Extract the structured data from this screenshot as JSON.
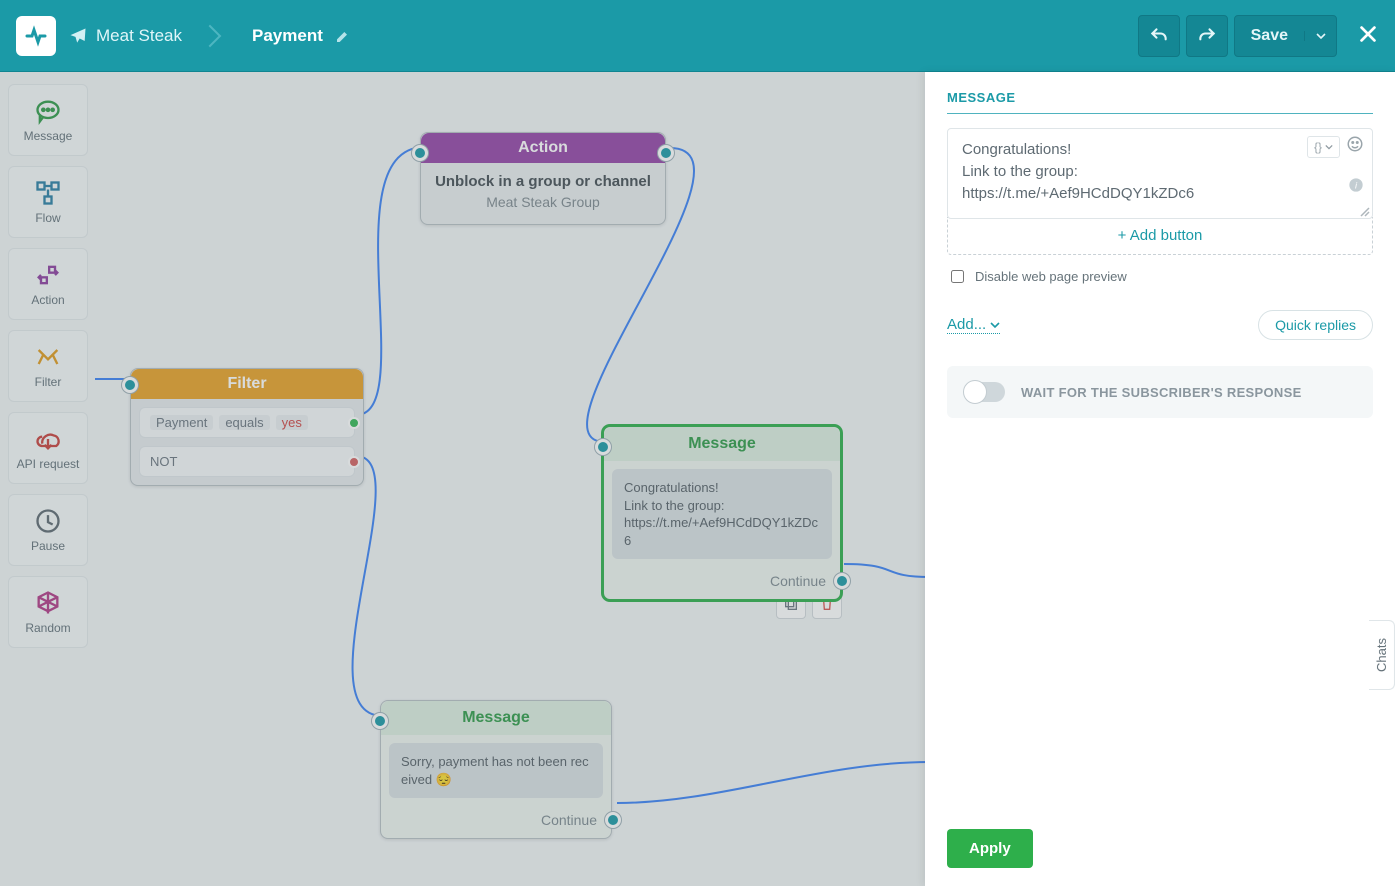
{
  "topbar": {
    "project": "Meat Steak",
    "page": "Payment",
    "save": "Save"
  },
  "sidebar": {
    "items": [
      {
        "label": "Message",
        "icon": "message",
        "color": "#2f9b49"
      },
      {
        "label": "Flow",
        "icon": "flow",
        "color": "#2a7fa5"
      },
      {
        "label": "Action",
        "icon": "action",
        "color": "#8e3fa0"
      },
      {
        "label": "Filter",
        "icon": "filter",
        "color": "#e09b1e"
      },
      {
        "label": "API request",
        "icon": "api",
        "color": "#c9403c"
      },
      {
        "label": "Pause",
        "icon": "pause",
        "color": "#5e6a72"
      },
      {
        "label": "Random",
        "icon": "random",
        "color": "#b23a87"
      }
    ]
  },
  "nodes": {
    "action": {
      "header": "Action",
      "title": "Unblock in a group or channel",
      "subtitle": "Meat Steak Group"
    },
    "filter": {
      "header": "Filter",
      "cond_field": "Payment",
      "cond_op": "equals",
      "cond_value": "yes",
      "not_label": "NOT"
    },
    "msg1": {
      "header": "Message",
      "text": "Congratulations!\nLink to the group:\nhttps://t.me/+Aef9HCdDQY1kZDc6",
      "continue": "Continue"
    },
    "msg2": {
      "header": "Message",
      "text": "Sorry, payment has not been received 😔",
      "continue": "Continue"
    }
  },
  "panel": {
    "title": "MESSAGE",
    "content": "Congratulations!\nLink to the group:\nhttps://t.me/+Aef9HCdDQY1kZDc6",
    "add_button": "+ Add button",
    "disable_preview": "Disable web page preview",
    "add": "Add...",
    "quick_replies": "Quick replies",
    "wait_label": "WAIT FOR THE SUBSCRIBER'S RESPONSE",
    "apply": "Apply"
  },
  "chats_tab": "Chats"
}
